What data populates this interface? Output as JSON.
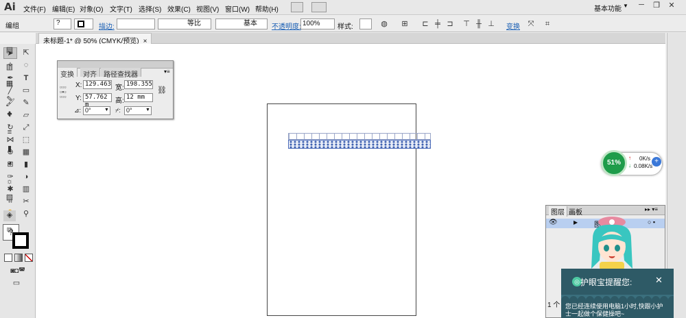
{
  "app": {
    "logo": "Ai",
    "workspace": "基本功能"
  },
  "menu": [
    "文件(F)",
    "编辑(E)",
    "对象(O)",
    "文字(T)",
    "选择(S)",
    "效果(C)",
    "视图(V)",
    "窗口(W)",
    "帮助(H)"
  ],
  "control": {
    "object_type": "编组",
    "fill_value": "?",
    "stroke_label": "描边:",
    "stroke_weight": "",
    "profile": "等比",
    "brush": "基本",
    "opacity_label": "不透明度:",
    "opacity_value": "100%",
    "style_label": "样式:",
    "transform_link": "变换"
  },
  "document": {
    "tab_title": "未标题-1* @ 50% (CMYK/预览)",
    "close": "×"
  },
  "transform_panel": {
    "tabs": [
      "变换",
      "对齐",
      "路径查找器"
    ],
    "x_label": "X:",
    "x_value": "129.463",
    "w_label": "宽:",
    "w_value": "198.355",
    "y_label": "Y:",
    "y_value": "57.762 m",
    "h_label": "高:",
    "h_value": "12 mm",
    "angle_value": "0°",
    "shear_value": "0°"
  },
  "layers_panel": {
    "tabs": [
      "图层",
      "画板"
    ],
    "layer_name": "图层",
    "footer": "1 个"
  },
  "speed_widget": {
    "percent": "51%",
    "up": "0K/s",
    "down": "0.08K/s"
  },
  "reminder": {
    "title": "护眼宝提醒您:",
    "close": "✕",
    "body": "您已经连续使用电脑1小时,快跟小护士一起做个保健操吧~"
  },
  "tool_fill_label": "?"
}
